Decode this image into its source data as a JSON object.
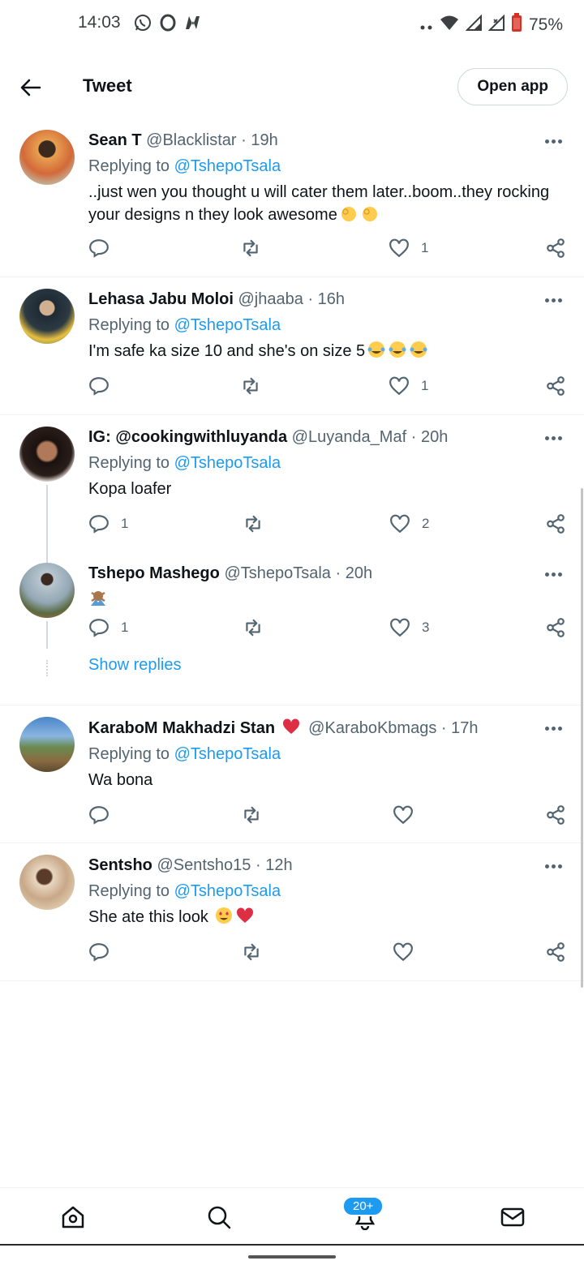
{
  "status_bar": {
    "time": "14:03",
    "left_icons": [
      "whatsapp-icon",
      "opera-icon",
      "news-icon"
    ],
    "right_icons": [
      "dots-icon",
      "wifi-icon",
      "signal-icon",
      "signal-x-icon",
      "battery-icon"
    ],
    "battery": "75%"
  },
  "header": {
    "title": "Tweet",
    "open_app": "Open app"
  },
  "tweets": [
    {
      "name": "Sean T",
      "handle": "@Blacklistar",
      "time": "19h",
      "replying_prefix": "Replying to ",
      "replying_to": "@TshepoTsala",
      "text": "..just wen you thought u will cater them later..boom..they rocking your designs n they look awesome",
      "reply_count": "",
      "retweet_count": "",
      "like_count": "1"
    },
    {
      "name": "Lehasa Jabu Moloi",
      "handle": "@jhaaba",
      "time": "16h",
      "replying_prefix": "Replying to ",
      "replying_to": "@TshepoTsala",
      "text": "I'm safe ka size 10 and she's on size 5",
      "reply_count": "",
      "retweet_count": "",
      "like_count": "1"
    },
    {
      "name": "IG: @cookingwithluyanda",
      "handle": "@Luyanda_Maf",
      "time": "20h",
      "replying_prefix": "Replying to ",
      "replying_to": "@TshepoTsala",
      "text": "Kopa loafer",
      "reply_count": "1",
      "retweet_count": "",
      "like_count": "2"
    },
    {
      "name": "Tshepo Mashego",
      "handle": "@TshepoTsala",
      "time": "20h",
      "text": "",
      "reply_count": "1",
      "retweet_count": "",
      "like_count": "3",
      "show_replies": "Show replies"
    },
    {
      "name": "KaraboM Makhadzi Stan",
      "handle": "@KaraboKbmags",
      "time": "17h",
      "replying_prefix": "Replying to ",
      "replying_to": "@TshepoTsala",
      "text": "Wa bona",
      "reply_count": "",
      "retweet_count": "",
      "like_count": ""
    },
    {
      "name": "Sentsho",
      "handle": "@Sentsho15",
      "time": "12h",
      "replying_prefix": "Replying to ",
      "replying_to": "@TshepoTsala",
      "text": "She ate this look",
      "reply_count": "",
      "retweet_count": "",
      "like_count": ""
    }
  ],
  "separator": "·",
  "bottom_nav": {
    "items": [
      "home-icon",
      "search-icon",
      "notifications-icon",
      "messages-icon"
    ],
    "notification_badge": "20+"
  },
  "colors": {
    "accent": "#1d9bf0",
    "text_primary": "#0f1419",
    "text_secondary": "#536471",
    "divider": "#eff3f4"
  }
}
